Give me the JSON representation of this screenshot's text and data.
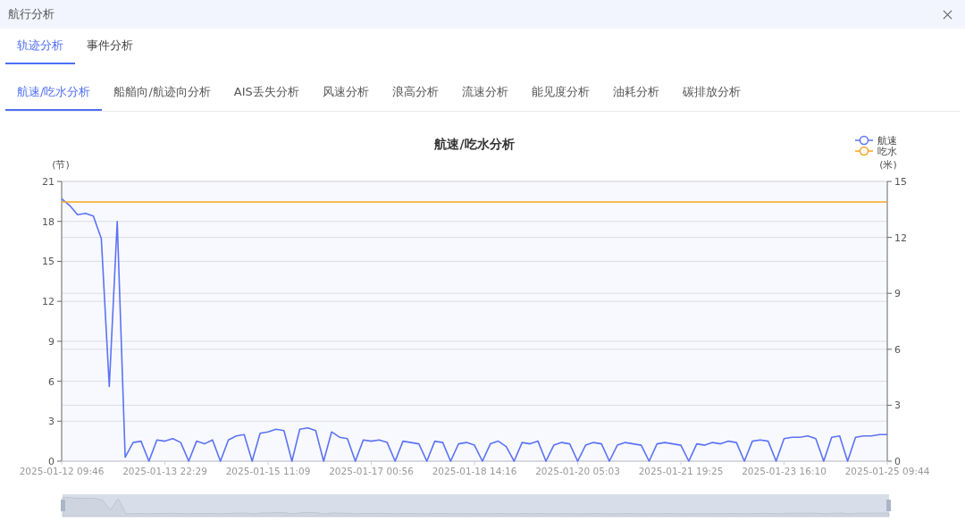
{
  "window": {
    "title": "航行分析"
  },
  "tabs": [
    {
      "label": "轨迹分析",
      "selected": true
    },
    {
      "label": "事件分析",
      "selected": false
    }
  ],
  "sub_tabs": [
    {
      "label": "航速/吃水分析",
      "selected": true
    },
    {
      "label": "船艏向/航迹向分析",
      "selected": false
    },
    {
      "label": "AIS丢失分析",
      "selected": false
    },
    {
      "label": "风速分析",
      "selected": false
    },
    {
      "label": "浪高分析",
      "selected": false
    },
    {
      "label": "流速分析",
      "selected": false
    },
    {
      "label": "能见度分析",
      "selected": false
    },
    {
      "label": "油耗分析",
      "selected": false
    },
    {
      "label": "碳排放分析",
      "selected": false
    }
  ],
  "chart": {
    "chart_data": {
      "type": "line",
      "title": "航速/吃水分析",
      "ylabel": "(节)",
      "y2label": "(米)",
      "categories": [
        "2025-01-12 09:46",
        null,
        null,
        null,
        null,
        null,
        null,
        null,
        null,
        null,
        null,
        null,
        null,
        "2025-01-13 22:29",
        null,
        null,
        null,
        null,
        null,
        null,
        null,
        null,
        null,
        null,
        null,
        null,
        "2025-01-15 11:09",
        null,
        null,
        null,
        null,
        null,
        null,
        null,
        null,
        null,
        null,
        null,
        null,
        "2025-01-17 00:56",
        null,
        null,
        null,
        null,
        null,
        null,
        null,
        null,
        null,
        null,
        null,
        null,
        "2025-01-18 14:16",
        null,
        null,
        null,
        null,
        null,
        null,
        null,
        null,
        null,
        null,
        null,
        null,
        "2025-01-20 05:03",
        null,
        null,
        null,
        null,
        null,
        null,
        null,
        null,
        null,
        null,
        null,
        null,
        "2025-01-21 19:25",
        null,
        null,
        null,
        null,
        null,
        null,
        null,
        null,
        null,
        null,
        null,
        null,
        "2025-01-23 16:10",
        null,
        null,
        null,
        null,
        null,
        null,
        null,
        null,
        null,
        null,
        null,
        null,
        "2025-01-25 09:44"
      ],
      "grid": true,
      "legend": "top-right",
      "ylim": [
        0,
        21
      ],
      "yticks": [
        0,
        3,
        6,
        9,
        12,
        15,
        18,
        21
      ],
      "y2lim": [
        0,
        15
      ],
      "y2ticks": [
        0,
        3,
        6,
        9,
        12,
        15
      ],
      "series": [
        {
          "name": "航速",
          "color": "#5b73f6",
          "values": [
            19.7,
            19.2,
            18.5,
            18.6,
            18.4,
            16.7,
            5.6,
            18,
            0.3,
            1.4,
            1.5,
            0,
            1.6,
            1.5,
            1.7,
            1.4,
            0,
            1.5,
            1.3,
            1.6,
            0,
            1.6,
            1.9,
            2,
            0,
            2.1,
            2.2,
            2.4,
            2.3,
            0,
            2.4,
            2.5,
            2.3,
            0,
            2.2,
            1.8,
            1.7,
            0,
            1.6,
            1.5,
            1.6,
            1.4,
            0,
            1.5,
            1.4,
            1.3,
            0,
            1.5,
            1.4,
            0,
            1.3,
            1.4,
            1.2,
            0,
            1.3,
            1.5,
            1.1,
            0,
            1.4,
            1.3,
            1.5,
            0,
            1.2,
            1.4,
            1.3,
            0,
            1.2,
            1.4,
            1.3,
            0,
            1.2,
            1.4,
            1.3,
            1.2,
            0,
            1.3,
            1.4,
            1.3,
            1.2,
            0,
            1.3,
            1.2,
            1.4,
            1.3,
            1.5,
            1.4,
            0,
            1.5,
            1.6,
            1.5,
            0,
            1.7,
            1.8,
            1.8,
            1.9,
            1.7,
            0,
            1.8,
            1.9,
            0,
            1.8,
            1.9,
            1.9,
            2,
            2
          ]
        },
        {
          "name": "吃水",
          "color": "#f5a623",
          "axis": "y2",
          "values": [
            13.9,
            13.9,
            13.9,
            13.9,
            13.9,
            13.9,
            13.9,
            13.9,
            13.9,
            13.9,
            13.9,
            13.9,
            13.9,
            13.9,
            13.9,
            13.9,
            13.9,
            13.9,
            13.9,
            13.9,
            13.9,
            13.9,
            13.9,
            13.9,
            13.9,
            13.9,
            13.9,
            13.9,
            13.9,
            13.9,
            13.9,
            13.9,
            13.9,
            13.9,
            13.9,
            13.9,
            13.9,
            13.9,
            13.9,
            13.9,
            13.9,
            13.9,
            13.9,
            13.9,
            13.9,
            13.9,
            13.9,
            13.9,
            13.9,
            13.9,
            13.9,
            13.9,
            13.9,
            13.9,
            13.9,
            13.9,
            13.9,
            13.9,
            13.9,
            13.9,
            13.9,
            13.9,
            13.9,
            13.9,
            13.9,
            13.9,
            13.9,
            13.9,
            13.9,
            13.9,
            13.9,
            13.9,
            13.9,
            13.9,
            13.9,
            13.9,
            13.9,
            13.9,
            13.9,
            13.9,
            13.9,
            13.9,
            13.9,
            13.9,
            13.9,
            13.9,
            13.9,
            13.9,
            13.9,
            13.9,
            13.9,
            13.9,
            13.9,
            13.9,
            13.9,
            13.9,
            13.9,
            13.9,
            13.9,
            13.9,
            13.9,
            13.9,
            13.9,
            13.9,
            13.9
          ]
        }
      ]
    }
  }
}
